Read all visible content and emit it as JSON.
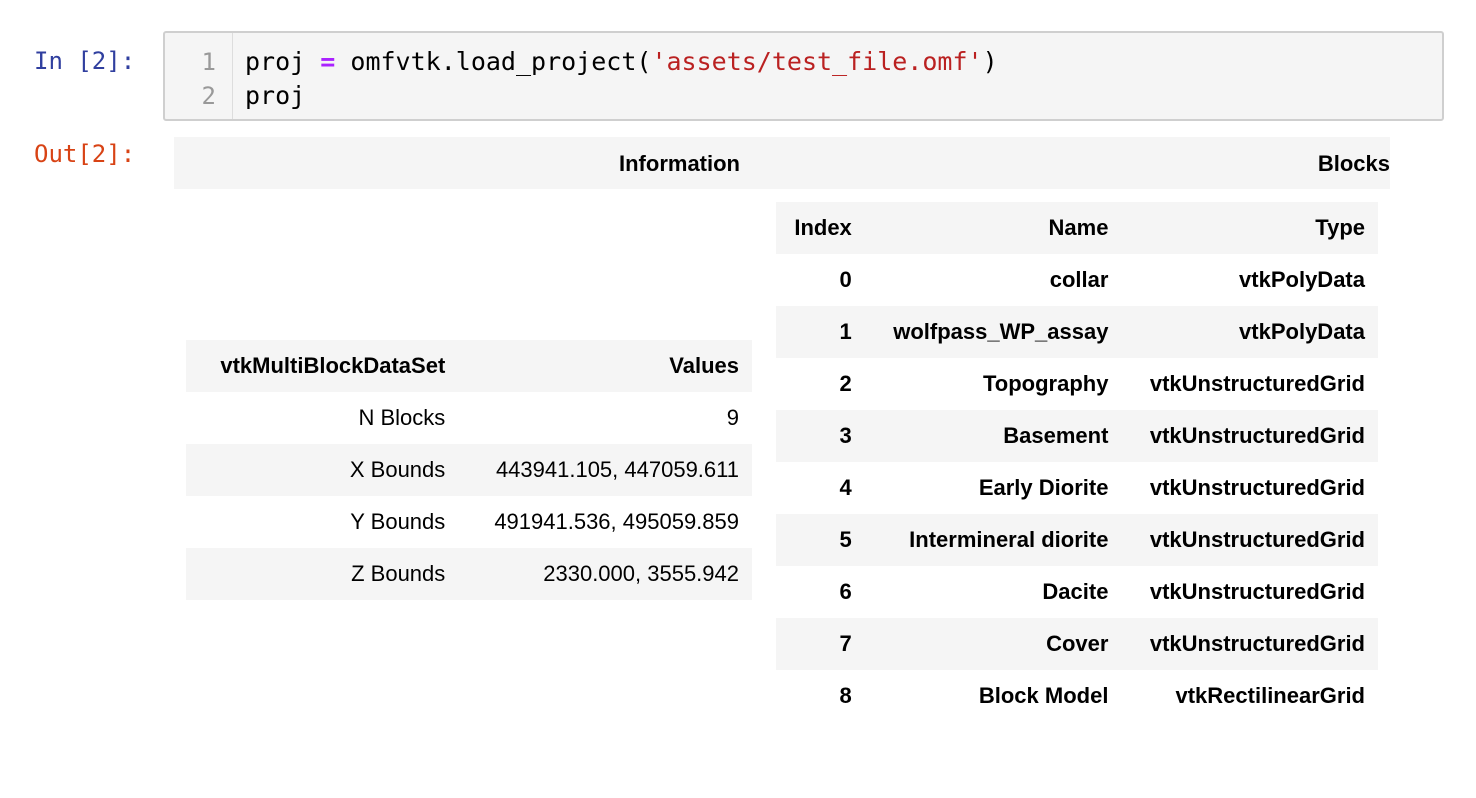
{
  "input_cell": {
    "prompt": "In [2]:",
    "line_numbers": [
      "1",
      "2"
    ],
    "line1": {
      "var": "proj",
      "op": "=",
      "call": "omfvtk.load_project(",
      "string": "'assets/test_file.omf'",
      "close": ")"
    },
    "line2": "proj"
  },
  "output_cell": {
    "prompt": "Out[2]:",
    "outer_headers": {
      "information": "Information",
      "blocks": "Blocks"
    },
    "info_table": {
      "headers": [
        "vtkMultiBlockDataSet",
        "Values"
      ],
      "rows": [
        [
          "N Blocks",
          "9"
        ],
        [
          "X Bounds",
          "443941.105, 447059.611"
        ],
        [
          "Y Bounds",
          "491941.536, 495059.859"
        ],
        [
          "Z Bounds",
          "2330.000, 3555.942"
        ]
      ]
    },
    "blocks_table": {
      "headers": [
        "Index",
        "Name",
        "Type"
      ],
      "rows": [
        [
          "0",
          "collar",
          "vtkPolyData"
        ],
        [
          "1",
          "wolfpass_WP_assay",
          "vtkPolyData"
        ],
        [
          "2",
          "Topography",
          "vtkUnstructuredGrid"
        ],
        [
          "3",
          "Basement",
          "vtkUnstructuredGrid"
        ],
        [
          "4",
          "Early Diorite",
          "vtkUnstructuredGrid"
        ],
        [
          "5",
          "Intermineral diorite",
          "vtkUnstructuredGrid"
        ],
        [
          "6",
          "Dacite",
          "vtkUnstructuredGrid"
        ],
        [
          "7",
          "Cover",
          "vtkUnstructuredGrid"
        ],
        [
          "8",
          "Block Model",
          "vtkRectilinearGrid"
        ]
      ]
    }
  }
}
